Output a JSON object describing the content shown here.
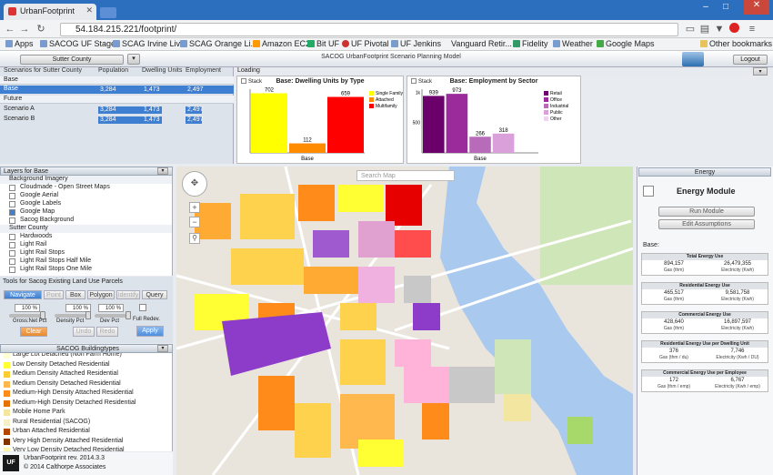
{
  "browser": {
    "tab_title": "UrbanFootprint",
    "url": "54.184.215.221/footprint/",
    "bookmarks": [
      "Apps",
      "SACOG UF Stage",
      "SCAG Irvine Live",
      "SCAG Orange Li...",
      "Amazon EC2",
      "Bit UF",
      "UF Pivotal",
      "UF Jenkins",
      "Vanguard Retir...",
      "Fidelity",
      "Weather",
      "Google Maps"
    ],
    "other_bookmarks": "Other bookmarks"
  },
  "header": {
    "county": "Sutter County",
    "title": "SACOG UrbanFootprint Scenario Planning Model",
    "logout": "Logout"
  },
  "scenarios": {
    "title": "Scenarios for Sutter County",
    "columns": [
      "Population",
      "Dwelling Units",
      "Employment"
    ],
    "groups": {
      "base": "Base",
      "future": "Future"
    },
    "rows": [
      {
        "name": "Base",
        "population": "3,284",
        "dwelling": "1,473",
        "employment": "2,497"
      },
      {
        "name": "Scenario A",
        "population": "3,284",
        "dwelling": "1,473",
        "employment": "2,497"
      },
      {
        "name": "Scenario B",
        "population": "3,284",
        "dwelling": "1,473",
        "employment": "2,497"
      }
    ]
  },
  "loading": "Loading",
  "charts": {
    "stack_label": "Stack",
    "xlabel": "Base",
    "dwelling": {
      "title": "Base: Dwelling Units by Type"
    },
    "employment": {
      "title": "Base: Employment by Sector"
    }
  },
  "chart_data": [
    {
      "type": "bar",
      "title": "Base: Dwelling Units by Type",
      "categories": [
        "Base"
      ],
      "series": [
        {
          "name": "Single Family",
          "values": [
            702
          ],
          "color": "#ffff00"
        },
        {
          "name": "Attached",
          "values": [
            112
          ],
          "color": "#ff8c00"
        },
        {
          "name": "Multifamily",
          "values": [
            659
          ],
          "color": "#ff0000"
        }
      ],
      "ylim": [
        0,
        750
      ],
      "legend": "right"
    },
    {
      "type": "bar",
      "title": "Base: Employment by Sector",
      "categories": [
        "Base"
      ],
      "yticks": [
        "1k",
        "500"
      ],
      "series": [
        {
          "name": "Retail",
          "values": [
            939
          ],
          "color": "#6b006b"
        },
        {
          "name": "Office",
          "values": [
            973
          ],
          "color": "#9b2a9b"
        },
        {
          "name": "Industrial",
          "values": [
            266
          ],
          "color": "#b86bb8"
        },
        {
          "name": "Public",
          "values": [
            318
          ],
          "color": "#d9a0d9"
        },
        {
          "name": "Other",
          "values": [
            0
          ],
          "color": "#eed4ee"
        }
      ],
      "ylim": [
        0,
        1050
      ],
      "legend": "right"
    }
  ],
  "layers": {
    "title": "Layers for Base",
    "items": [
      {
        "label": "Background Imagery",
        "group": true
      },
      {
        "label": "Cloudmade - Open Street Maps",
        "checked": false
      },
      {
        "label": "Google Aerial",
        "checked": false
      },
      {
        "label": "Google Labels",
        "checked": false
      },
      {
        "label": "Google Map",
        "checked": true
      },
      {
        "label": "Sacog Background",
        "checked": false
      },
      {
        "label": "Sutter County",
        "group": true
      },
      {
        "label": "Hardwoods",
        "checked": false
      },
      {
        "label": "Light Rail",
        "checked": false
      },
      {
        "label": "Light Rail Stops",
        "checked": false
      },
      {
        "label": "Light Rail Stops Half Mile",
        "checked": false
      },
      {
        "label": "Light Rail Stops One Mile",
        "checked": false
      }
    ]
  },
  "tools": {
    "title": "Tools for Sacog Existing Land Use Parcels",
    "buttons": [
      "Navigate",
      "Point",
      "Box",
      "Polygon",
      "Identify",
      "Query"
    ],
    "fields": [
      {
        "label": "Gross:Net Pct",
        "value": "100 %"
      },
      {
        "label": "Density Pct",
        "value": "100 %"
      },
      {
        "label": "Dev Pct",
        "value": "100 %"
      }
    ],
    "full_redev": "Full Redev.",
    "clear": "Clear",
    "undo": "Undo",
    "redo": "Redo",
    "apply": "Apply"
  },
  "buildingtypes": {
    "title": "SACOG Buildingtypes",
    "items": [
      {
        "label": "Large Lot Detached (Non Farm Home)",
        "color": "#ffffd4"
      },
      {
        "label": "Low Density Detached Residential",
        "color": "#ffff33"
      },
      {
        "label": "Medium Density Attached Residential",
        "color": "#ffcc33"
      },
      {
        "label": "Medium Density Detached Residential",
        "color": "#ffb84d"
      },
      {
        "label": "Medium-High Density Attached Residential",
        "color": "#ff8c1a"
      },
      {
        "label": "Medium-High Density Detached Residential",
        "color": "#e67300"
      },
      {
        "label": "Mobile Home Park",
        "color": "#f2e6a0"
      },
      {
        "label": "Rural Residential (SACOG)",
        "color": "#f5f0c8"
      },
      {
        "label": "Urban Attached Residential",
        "color": "#b34700"
      },
      {
        "label": "Very High Density Attached Residential",
        "color": "#803300"
      },
      {
        "label": "Very Low Density Detached Residential",
        "color": "#fff5b0"
      }
    ]
  },
  "footer": {
    "version": "UrbanFootprint rev. 2014.3.3",
    "copyright": "© 2014 Calthorpe Associates",
    "logo": "UF"
  },
  "map": {
    "search_placeholder": "Search Map"
  },
  "energy": {
    "tab": "Energy",
    "title": "Energy Module",
    "run": "Run Module",
    "edit": "Edit Assumptions",
    "base_label": "Base:",
    "boxes": [
      {
        "title": "Total Energy Use",
        "v1": "894,157",
        "u1": "Gas (thm)",
        "v2": "26,479,355",
        "u2": "Electricity (Kwh)"
      },
      {
        "title": "Residential Energy Use",
        "v1": "465,517",
        "u1": "Gas (thm)",
        "v2": "9,581,758",
        "u2": "Electricity (Kwh)"
      },
      {
        "title": "Commercial Energy Use",
        "v1": "428,640",
        "u1": "Gas (thm)",
        "v2": "16,897,597",
        "u2": "Electricity (Kwh)"
      },
      {
        "title": "Residential Energy Use per Dwelling Unit",
        "v1": "376",
        "u1": "Gas (thm / du)",
        "v2": "7,746",
        "u2": "Electricity (Kwh / DU)"
      },
      {
        "title": "Commercial Energy Use per Employee",
        "v1": "172",
        "u1": "Gas (thm / emp)",
        "v2": "6,767",
        "u2": "Electricity (Kwh / emp)"
      }
    ]
  }
}
